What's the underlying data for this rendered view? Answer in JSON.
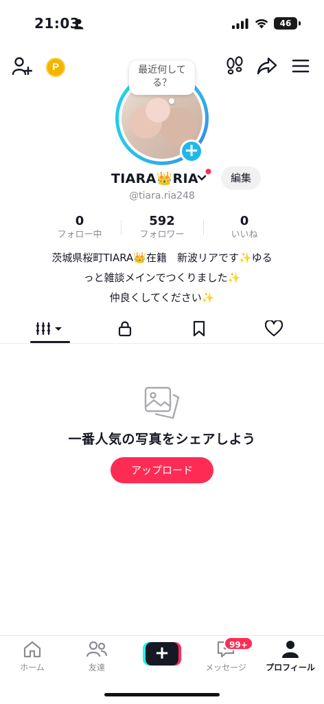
{
  "status_bar": {
    "time": "21:03",
    "battery": "46"
  },
  "profile": {
    "bubble_text": "最近何してる？",
    "display_name": "TIARA👑RIA",
    "handle": "@tiara.ria248",
    "edit_label": "編集",
    "bio_lines": [
      "茨城県桜町TIARA👑在籍　新波リアです✨ゆる",
      "っと雑談メインでつくりました✨",
      "仲良くしてください✨"
    ]
  },
  "stats": [
    {
      "value": "0",
      "label": "フォロー中"
    },
    {
      "value": "592",
      "label": "フォロワー"
    },
    {
      "value": "0",
      "label": "いいね"
    }
  ],
  "empty_state": {
    "text": "一番人気の写真をシェアしよう",
    "button": "アップロード"
  },
  "bottom_nav": {
    "home": "ホーム",
    "friends": "友達",
    "create": "+",
    "messages": "メッセージ",
    "messages_badge": "99+",
    "profile": "プロフィール"
  },
  "colors": {
    "accent": "#fe2c55",
    "cyan": "#25f4ee",
    "coin": "#f5b400",
    "ring": "#20b8e8"
  },
  "icons": [
    "add-user-icon",
    "coin-icon",
    "footprints-icon",
    "share-icon",
    "menu-icon",
    "grid-icon",
    "lock-icon",
    "bookmark-icon",
    "heart-icon",
    "photo-icon",
    "home-icon",
    "friends-icon",
    "message-icon",
    "profile-icon"
  ]
}
